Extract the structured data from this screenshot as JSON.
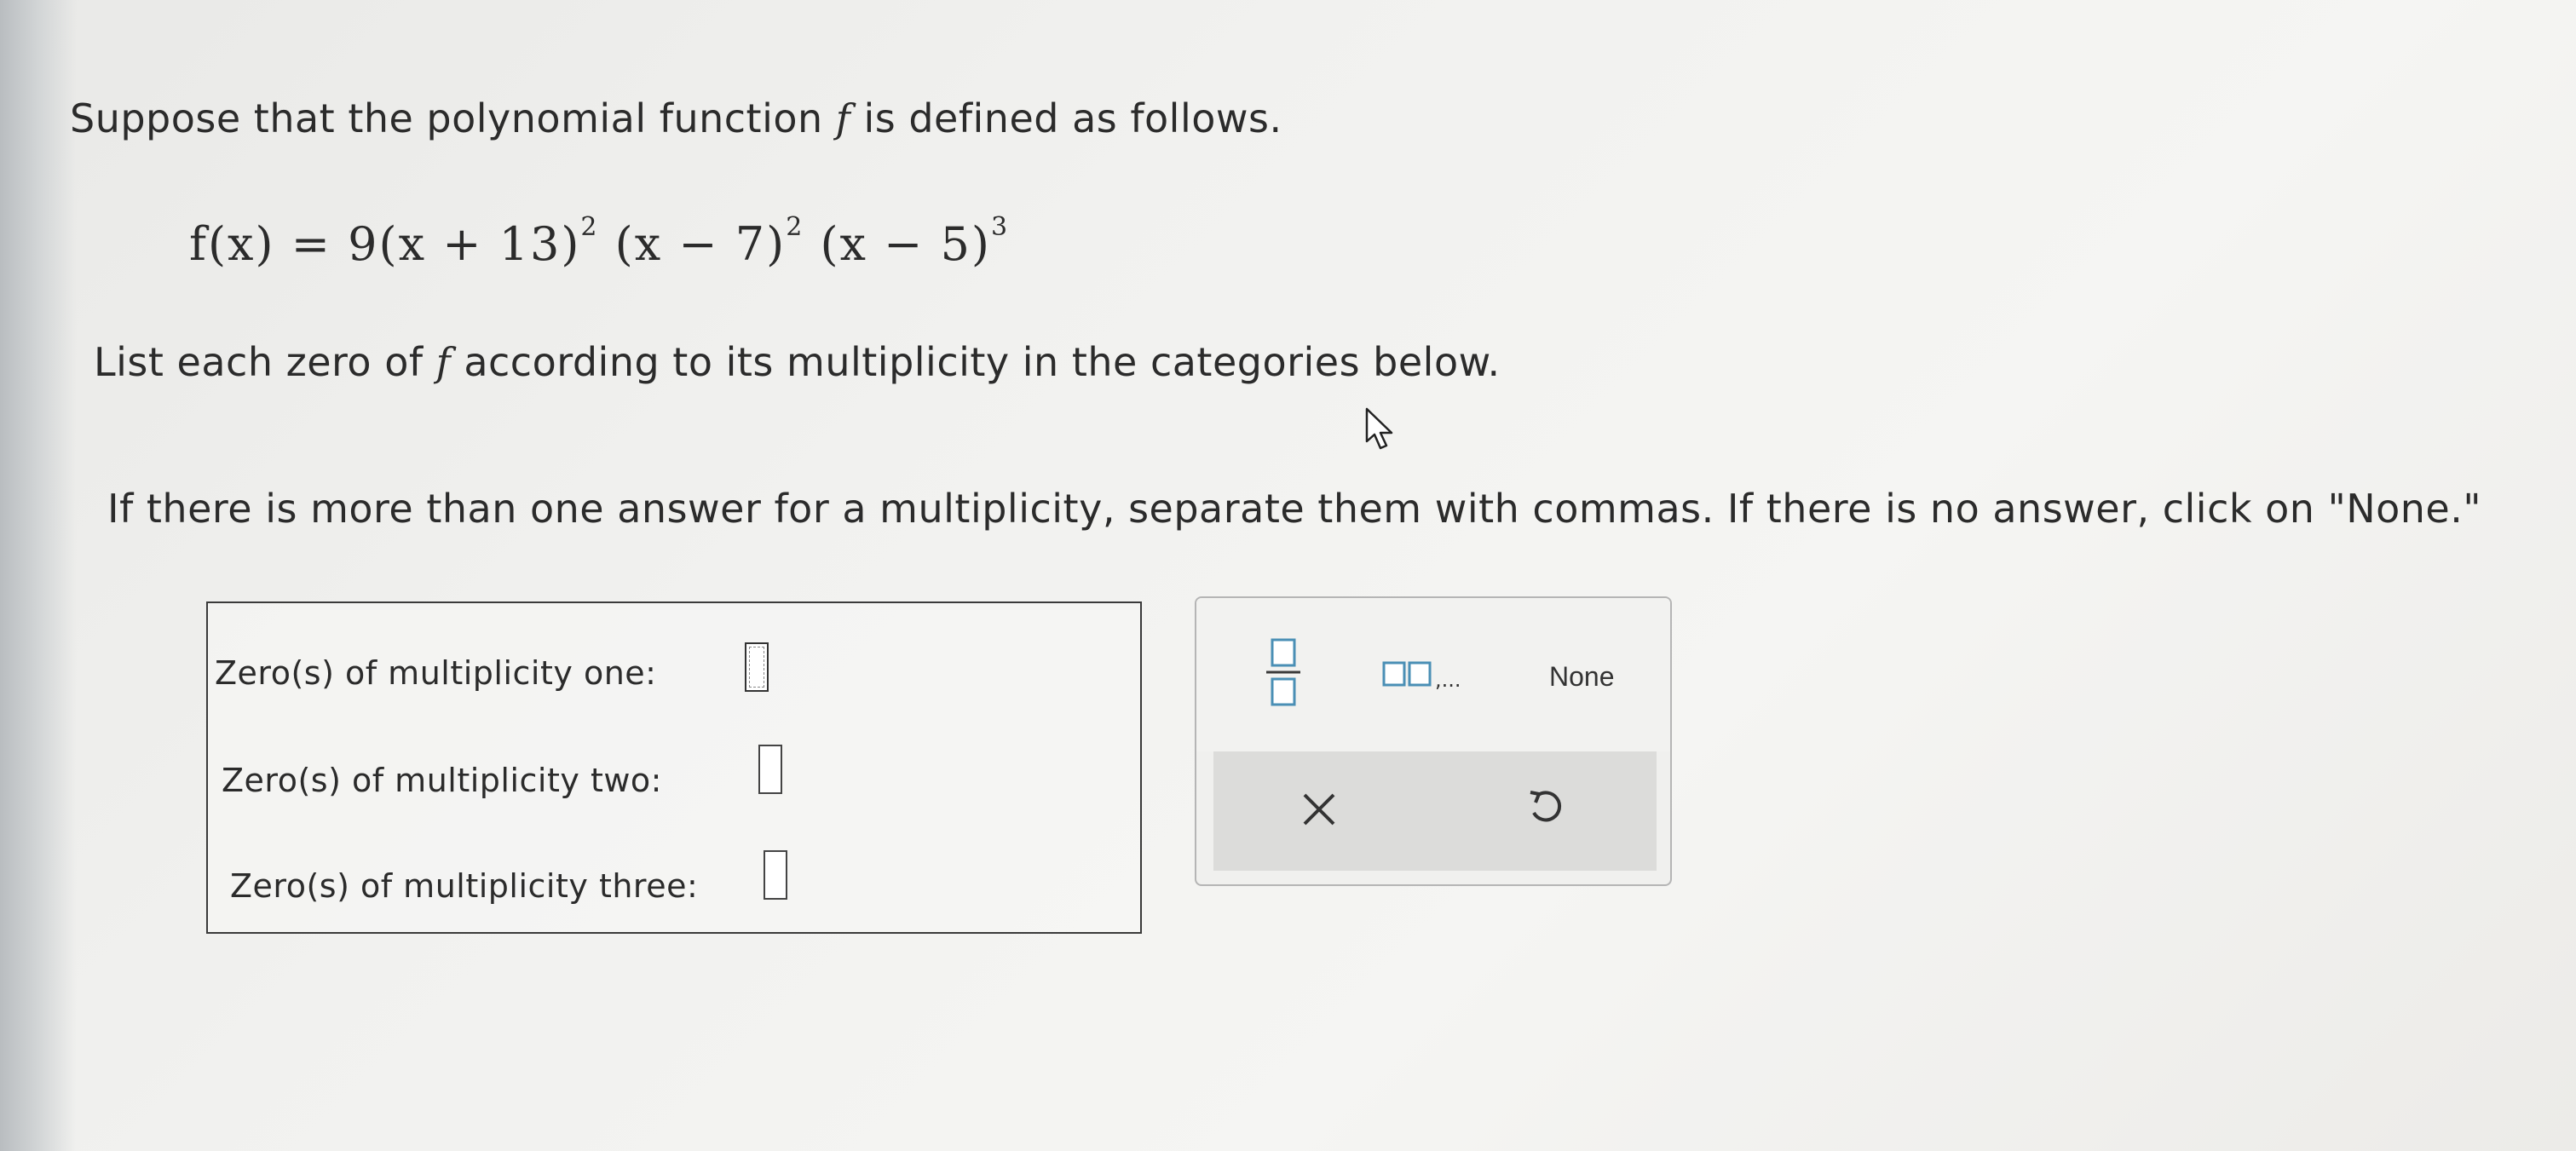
{
  "question": {
    "prompt_before": "Suppose that the polynomial function ",
    "prompt_var": "f",
    "prompt_after": " is defined as follows.",
    "formula": {
      "lhs": "f(x) = 9",
      "factor1": "(x + 13)",
      "exp1": "2",
      "factor2": "(x − 7)",
      "exp2": "2",
      "factor3": "(x − 5)",
      "exp3": "3"
    },
    "instruction_before": "List each zero of ",
    "instruction_var": "f",
    "instruction_after": " according to its multiplicity in the categories below.",
    "separator_note": "If there is more than one answer for a multiplicity, separate them with commas. If there is no answer, click on \"None.\""
  },
  "answers": {
    "rows": [
      {
        "label": "Zero(s) of multiplicity one:",
        "value": ""
      },
      {
        "label": "Zero(s) of multiplicity two:",
        "value": ""
      },
      {
        "label": "Zero(s) of multiplicity three:",
        "value": ""
      }
    ]
  },
  "keypad": {
    "fraction_icon": "fraction-template-icon",
    "list_icon": "list-template-icon",
    "list_suffix": ",...",
    "none_label": "None",
    "clear_icon": "x-icon",
    "undo_icon": "undo-icon"
  },
  "colors": {
    "keypad_icon": "#4a8fb5",
    "keypad_dark": "#3a3a3a"
  }
}
